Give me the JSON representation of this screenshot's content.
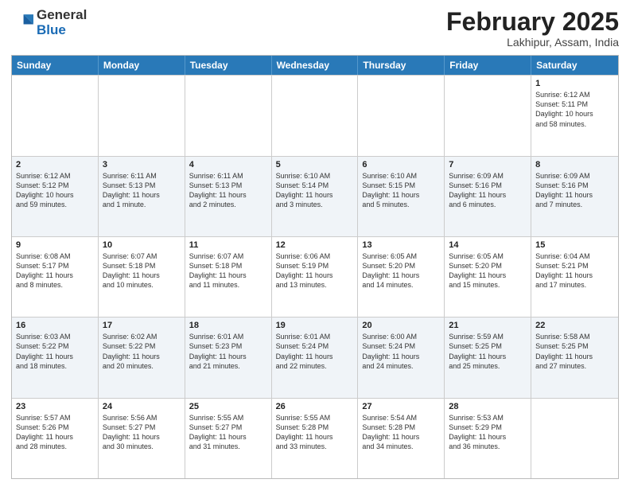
{
  "header": {
    "logo": {
      "general": "General",
      "blue": "Blue"
    },
    "title": "February 2025",
    "subtitle": "Lakhipur, Assam, India"
  },
  "days": [
    "Sunday",
    "Monday",
    "Tuesday",
    "Wednesday",
    "Thursday",
    "Friday",
    "Saturday"
  ],
  "weeks": [
    [
      {
        "day": "",
        "text": ""
      },
      {
        "day": "",
        "text": ""
      },
      {
        "day": "",
        "text": ""
      },
      {
        "day": "",
        "text": ""
      },
      {
        "day": "",
        "text": ""
      },
      {
        "day": "",
        "text": ""
      },
      {
        "day": "1",
        "text": "Sunrise: 6:12 AM\nSunset: 5:11 PM\nDaylight: 10 hours\nand 58 minutes."
      }
    ],
    [
      {
        "day": "2",
        "text": "Sunrise: 6:12 AM\nSunset: 5:12 PM\nDaylight: 10 hours\nand 59 minutes."
      },
      {
        "day": "3",
        "text": "Sunrise: 6:11 AM\nSunset: 5:13 PM\nDaylight: 11 hours\nand 1 minute."
      },
      {
        "day": "4",
        "text": "Sunrise: 6:11 AM\nSunset: 5:13 PM\nDaylight: 11 hours\nand 2 minutes."
      },
      {
        "day": "5",
        "text": "Sunrise: 6:10 AM\nSunset: 5:14 PM\nDaylight: 11 hours\nand 3 minutes."
      },
      {
        "day": "6",
        "text": "Sunrise: 6:10 AM\nSunset: 5:15 PM\nDaylight: 11 hours\nand 5 minutes."
      },
      {
        "day": "7",
        "text": "Sunrise: 6:09 AM\nSunset: 5:16 PM\nDaylight: 11 hours\nand 6 minutes."
      },
      {
        "day": "8",
        "text": "Sunrise: 6:09 AM\nSunset: 5:16 PM\nDaylight: 11 hours\nand 7 minutes."
      }
    ],
    [
      {
        "day": "9",
        "text": "Sunrise: 6:08 AM\nSunset: 5:17 PM\nDaylight: 11 hours\nand 8 minutes."
      },
      {
        "day": "10",
        "text": "Sunrise: 6:07 AM\nSunset: 5:18 PM\nDaylight: 11 hours\nand 10 minutes."
      },
      {
        "day": "11",
        "text": "Sunrise: 6:07 AM\nSunset: 5:18 PM\nDaylight: 11 hours\nand 11 minutes."
      },
      {
        "day": "12",
        "text": "Sunrise: 6:06 AM\nSunset: 5:19 PM\nDaylight: 11 hours\nand 13 minutes."
      },
      {
        "day": "13",
        "text": "Sunrise: 6:05 AM\nSunset: 5:20 PM\nDaylight: 11 hours\nand 14 minutes."
      },
      {
        "day": "14",
        "text": "Sunrise: 6:05 AM\nSunset: 5:20 PM\nDaylight: 11 hours\nand 15 minutes."
      },
      {
        "day": "15",
        "text": "Sunrise: 6:04 AM\nSunset: 5:21 PM\nDaylight: 11 hours\nand 17 minutes."
      }
    ],
    [
      {
        "day": "16",
        "text": "Sunrise: 6:03 AM\nSunset: 5:22 PM\nDaylight: 11 hours\nand 18 minutes."
      },
      {
        "day": "17",
        "text": "Sunrise: 6:02 AM\nSunset: 5:22 PM\nDaylight: 11 hours\nand 20 minutes."
      },
      {
        "day": "18",
        "text": "Sunrise: 6:01 AM\nSunset: 5:23 PM\nDaylight: 11 hours\nand 21 minutes."
      },
      {
        "day": "19",
        "text": "Sunrise: 6:01 AM\nSunset: 5:24 PM\nDaylight: 11 hours\nand 22 minutes."
      },
      {
        "day": "20",
        "text": "Sunrise: 6:00 AM\nSunset: 5:24 PM\nDaylight: 11 hours\nand 24 minutes."
      },
      {
        "day": "21",
        "text": "Sunrise: 5:59 AM\nSunset: 5:25 PM\nDaylight: 11 hours\nand 25 minutes."
      },
      {
        "day": "22",
        "text": "Sunrise: 5:58 AM\nSunset: 5:25 PM\nDaylight: 11 hours\nand 27 minutes."
      }
    ],
    [
      {
        "day": "23",
        "text": "Sunrise: 5:57 AM\nSunset: 5:26 PM\nDaylight: 11 hours\nand 28 minutes."
      },
      {
        "day": "24",
        "text": "Sunrise: 5:56 AM\nSunset: 5:27 PM\nDaylight: 11 hours\nand 30 minutes."
      },
      {
        "day": "25",
        "text": "Sunrise: 5:55 AM\nSunset: 5:27 PM\nDaylight: 11 hours\nand 31 minutes."
      },
      {
        "day": "26",
        "text": "Sunrise: 5:55 AM\nSunset: 5:28 PM\nDaylight: 11 hours\nand 33 minutes."
      },
      {
        "day": "27",
        "text": "Sunrise: 5:54 AM\nSunset: 5:28 PM\nDaylight: 11 hours\nand 34 minutes."
      },
      {
        "day": "28",
        "text": "Sunrise: 5:53 AM\nSunset: 5:29 PM\nDaylight: 11 hours\nand 36 minutes."
      },
      {
        "day": "",
        "text": ""
      }
    ]
  ]
}
